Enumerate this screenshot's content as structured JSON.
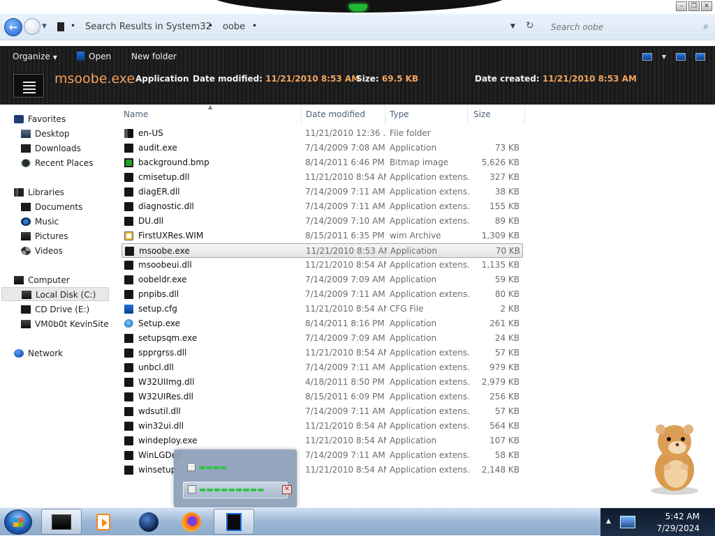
{
  "window": {
    "controls": [
      "minimize",
      "restore",
      "close"
    ]
  },
  "address_bar": {
    "breadcrumb": [
      "Search Results in System32",
      "oobe"
    ],
    "search_placeholder": "Search oobe"
  },
  "toolbar": {
    "organize_label": "Organize",
    "open_label": "Open",
    "new_folder_label": "New folder"
  },
  "details": {
    "name": "msoobe.exe",
    "type": "Application",
    "date_modified_label": "Date modified:",
    "date_modified": "11/21/2010 8:53 AM",
    "size_label": "Size:",
    "size": "69.5 KB",
    "date_created_label": "Date created:",
    "date_created": "11/21/2010 8:53 AM"
  },
  "nav_pane": {
    "favorites": "Favorites",
    "desktop": "Desktop",
    "downloads": "Downloads",
    "recent": "Recent Places",
    "libraries": "Libraries",
    "documents": "Documents",
    "music": "Music",
    "pictures": "Pictures",
    "videos": "Videos",
    "computer": "Computer",
    "local_disk": "Local Disk (C:)",
    "cd_drive": "CD Drive (E:)",
    "vm_site": "VM0b0t KevinSite",
    "network": "Network"
  },
  "columns": {
    "name": "Name",
    "date": "Date modified",
    "type": "Type",
    "size": "Size"
  },
  "files": [
    {
      "name": "en-US",
      "date": "11/21/2010 12:36 ...",
      "type": "File folder",
      "size": "",
      "icon": "folder-icon"
    },
    {
      "name": "audit.exe",
      "date": "7/14/2009 7:08 AM",
      "type": "Application",
      "size": "73 KB",
      "icon": "exe-icon"
    },
    {
      "name": "background.bmp",
      "date": "8/14/2011 6:46 PM",
      "type": "Bitmap image",
      "size": "5,626 KB",
      "icon": "bitmap-icon"
    },
    {
      "name": "cmisetup.dll",
      "date": "11/21/2010 8:54 AM",
      "type": "Application extens...",
      "size": "327 KB",
      "icon": "dll-icon"
    },
    {
      "name": "diagER.dll",
      "date": "7/14/2009 7:11 AM",
      "type": "Application extens...",
      "size": "38 KB",
      "icon": "dll-icon"
    },
    {
      "name": "diagnostic.dll",
      "date": "7/14/2009 7:11 AM",
      "type": "Application extens...",
      "size": "155 KB",
      "icon": "dll-icon"
    },
    {
      "name": "DU.dll",
      "date": "7/14/2009 7:10 AM",
      "type": "Application extens...",
      "size": "89 KB",
      "icon": "dll-icon"
    },
    {
      "name": "FirstUXRes.WIM",
      "date": "8/15/2011 6:35 PM",
      "type": "wim Archive",
      "size": "1,309 KB",
      "icon": "wim-icon"
    },
    {
      "name": "msoobe.exe",
      "date": "11/21/2010 8:53 AM",
      "type": "Application",
      "size": "70 KB",
      "icon": "exe-icon",
      "selected": true
    },
    {
      "name": "msoobeui.dll",
      "date": "11/21/2010 8:54 AM",
      "type": "Application extens...",
      "size": "1,135 KB",
      "icon": "dll-icon"
    },
    {
      "name": "oobeldr.exe",
      "date": "7/14/2009 7:09 AM",
      "type": "Application",
      "size": "59 KB",
      "icon": "exe-icon"
    },
    {
      "name": "pnpibs.dll",
      "date": "7/14/2009 7:11 AM",
      "type": "Application extens...",
      "size": "80 KB",
      "icon": "dll-icon"
    },
    {
      "name": "setup.cfg",
      "date": "11/21/2010 8:54 AM",
      "type": "CFG File",
      "size": "2 KB",
      "icon": "cfg-icon"
    },
    {
      "name": "Setup.exe",
      "date": "8/14/2011 8:16 PM",
      "type": "Application",
      "size": "261 KB",
      "icon": "setup-icon"
    },
    {
      "name": "setupsqm.exe",
      "date": "7/14/2009 7:09 AM",
      "type": "Application",
      "size": "24 KB",
      "icon": "exe-icon"
    },
    {
      "name": "spprgrss.dll",
      "date": "11/21/2010 8:54 AM",
      "type": "Application extens...",
      "size": "57 KB",
      "icon": "dll-icon"
    },
    {
      "name": "unbcl.dll",
      "date": "7/14/2009 7:11 AM",
      "type": "Application extens...",
      "size": "979 KB",
      "icon": "dll-icon"
    },
    {
      "name": "W32UIImg.dll",
      "date": "4/18/2011 8:50 PM",
      "type": "Application extens...",
      "size": "2,979 KB",
      "icon": "dll-icon"
    },
    {
      "name": "W32UIRes.dll",
      "date": "8/15/2011 6:09 PM",
      "type": "Application extens...",
      "size": "256 KB",
      "icon": "dll-icon"
    },
    {
      "name": "wdsutil.dll",
      "date": "7/14/2009 7:11 AM",
      "type": "Application extens...",
      "size": "57 KB",
      "icon": "dll-icon"
    },
    {
      "name": "win32ui.dll",
      "date": "11/21/2010 8:54 AM",
      "type": "Application extens...",
      "size": "564 KB",
      "icon": "dll-icon"
    },
    {
      "name": "windeploy.exe",
      "date": "11/21/2010 8:54 AM",
      "type": "Application",
      "size": "107 KB",
      "icon": "exe-icon"
    },
    {
      "name": "WinLGDep",
      "date": "7/14/2009 7:11 AM",
      "type": "Application extens...",
      "size": "58 KB",
      "icon": "dll-icon"
    },
    {
      "name": "winsetup.",
      "date": "11/21/2010 8:54 AM",
      "type": "Application extens...",
      "size": "2,148 KB",
      "icon": "dll-icon"
    }
  ],
  "taskbar": {
    "time": "5:42 AM",
    "date": "7/29/2024"
  }
}
